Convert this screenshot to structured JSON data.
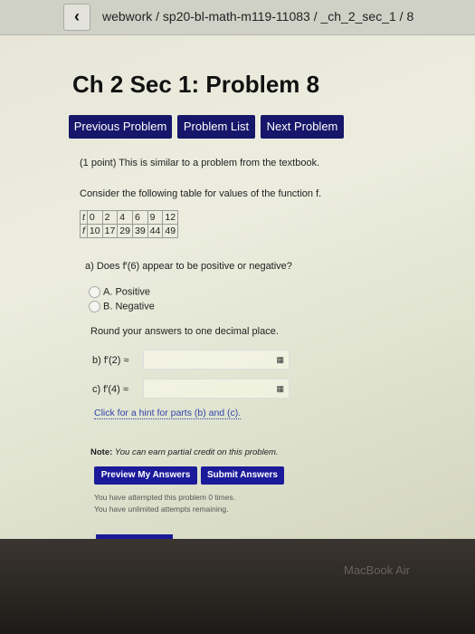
{
  "header": {
    "back_icon": "chevron-left-icon",
    "breadcrumb": "webwork / sp20-bl-math-m119-11083 / _ch_2_sec_1 / 8"
  },
  "title": "Ch 2 Sec 1: Problem 8",
  "nav": {
    "previous": "Previous Problem",
    "list": "Problem List",
    "next": "Next Problem"
  },
  "problem": {
    "intro": "(1 point) This is similar to a problem from the textbook.",
    "consider": "Consider the following table for values of the function f.",
    "table": {
      "row_t": [
        "t",
        "0",
        "2",
        "4",
        "6",
        "9",
        "12"
      ],
      "row_f": [
        "f",
        "10",
        "17",
        "29",
        "39",
        "44",
        "49"
      ]
    },
    "part_a": "a) Does f′(6) appear to be positive or negative?",
    "options": [
      "A. Positive",
      "B. Negative"
    ],
    "round": "Round your answers to one decimal place.",
    "part_b": "b) f′(2) ≈",
    "part_c": "c) f′(4) ≈",
    "hint": "Click for a hint for parts (b) and (c).",
    "note_label": "Note:",
    "note": "You can earn partial credit on this problem."
  },
  "buttons": {
    "preview": "Preview My Answers",
    "submit": "Submit Answers"
  },
  "status": {
    "attempts": "You have attempted this problem 0 times.",
    "remaining": "You have unlimited attempts remaining."
  },
  "bezel": {
    "label": "MacBook Air"
  }
}
